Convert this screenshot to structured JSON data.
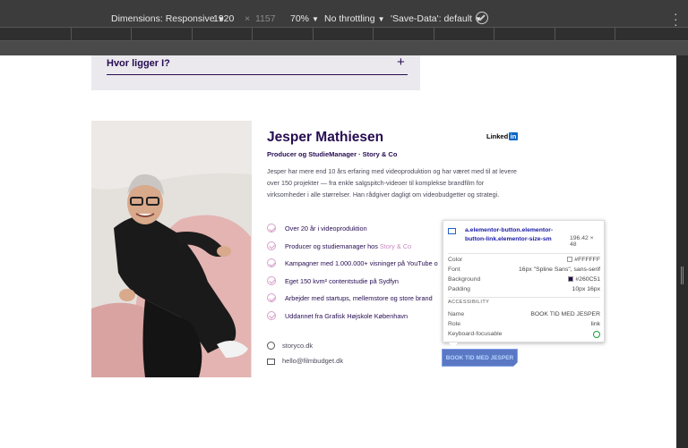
{
  "devtools": {
    "dimensions_label": "Dimensions: Responsive",
    "width": "1920",
    "times": "×",
    "height": "1157",
    "zoom": "70%",
    "throttle": "No throttling",
    "save_data": "'Save-Data': default"
  },
  "faq": {
    "question": "Hvor ligger I?",
    "toggle": "+"
  },
  "profile": {
    "name": "Jesper Mathiesen",
    "role": "Producer og StudieManager · Story & Co",
    "linkedin_text": "Linked",
    "linkedin_badge": "in",
    "bio": "Jesper har mere end 10 års erfaring med videoproduktion og har været med til at levere over 150 projekter — fra enkle salgspitch-videoer til komplekse brandfilm for virksomheder i alle størrelser. Han rådgiver dagligt om videobudgetter og strategi.",
    "bullets": [
      {
        "text": "Over 20 år i videoproduktion"
      },
      {
        "text": "Producer og studiemanager hos ",
        "accent": "Story & Co"
      },
      {
        "text": "Kampagner med 1.000.000+ visninger på YouTube o"
      },
      {
        "text": "Eget 150 kvm² contentstudie på Sydfyn"
      },
      {
        "text": "Arbejder med startups, mellemstore og store brand"
      },
      {
        "text": "Uddannet fra Grafisk Højskole København"
      }
    ],
    "website": "storyco.dk",
    "email": "hello@filmbudget.dk",
    "button": "BOOK TID MED JESPER"
  },
  "inspector": {
    "selector": "a.elementor-button.elementor-button-link.elementor-size-sm",
    "size": "196.42 × 48",
    "rows": [
      {
        "k": "Color",
        "v": "#FFFFFF",
        "swatch": "#ffffff"
      },
      {
        "k": "Font",
        "v": "16px \"Spline Sans\", sans-serif"
      },
      {
        "k": "Background",
        "v": "#260C51",
        "swatch": "#260c51"
      },
      {
        "k": "Padding",
        "v": "10px 16px"
      }
    ],
    "accessibility_title": "ACCESSIBILITY",
    "acc_rows": [
      {
        "k": "Name",
        "v": "BOOK TID MED JESPER"
      },
      {
        "k": "Role",
        "v": "link"
      },
      {
        "k": "Keyboard-focusable",
        "v": ""
      }
    ]
  }
}
